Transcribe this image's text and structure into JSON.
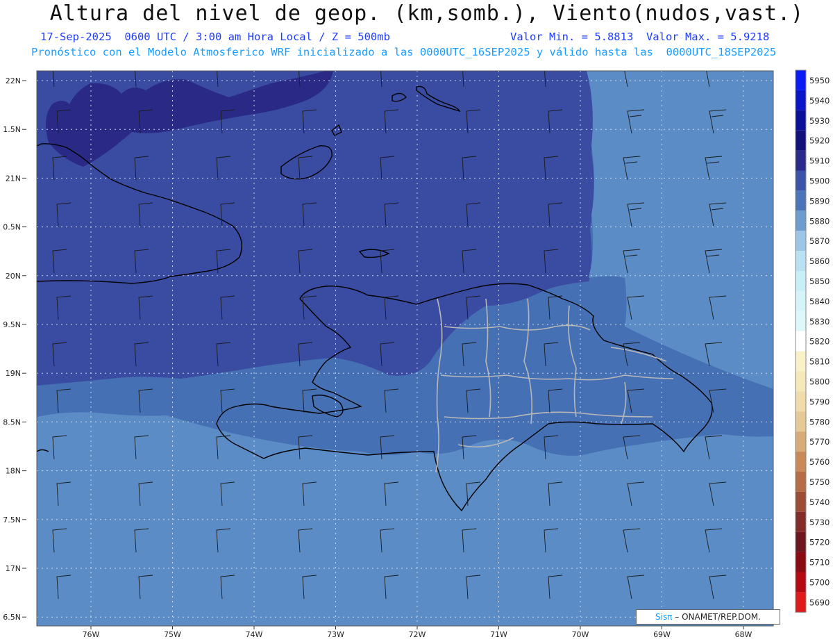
{
  "header": {
    "title": "Altura del nivel de geop. (km,somb.), Viento(nudos,vast.)",
    "date_line": "17-Sep-2025  0600 UTC / 3:00 am Hora Local / Z = 500mb",
    "minmax_line": "Valor Min. = 5.8813  Valor Max. = 5.9218",
    "model_line": "Pronóstico con el Modelo Atmosferico WRF inicializado a las 0000UTC_16SEP2025 y válido hasta las  0000UTC_18SEP2025"
  },
  "axes": {
    "lat_labels": [
      "22N",
      "1.5N",
      "21N",
      "0.5N",
      "20N",
      "9.5N",
      "19N",
      "8.5N",
      "18N",
      "7.5N",
      "17N",
      "6.5N"
    ],
    "lon_labels": [
      "76W",
      "75W",
      "74W",
      "73W",
      "72W",
      "71W",
      "70W",
      "69W",
      "68W"
    ]
  },
  "colorbar": {
    "labels": [
      "5950",
      "5940",
      "5930",
      "5920",
      "5910",
      "5900",
      "5890",
      "5880",
      "5870",
      "5860",
      "5850",
      "5840",
      "5830",
      "5820",
      "5810",
      "5800",
      "5790",
      "5780",
      "5770",
      "5760",
      "5750",
      "5740",
      "5730",
      "5720",
      "5710",
      "5700",
      "5690"
    ],
    "colors": [
      "#0a1cf5",
      "#0a14c8",
      "#0b0f9a",
      "#12107a",
      "#2a2a8a",
      "#3b53a8",
      "#4a75b8",
      "#6e9ccf",
      "#9dc6e6",
      "#b9e1f2",
      "#c8eef7",
      "#d6f3fa",
      "#ddf7fb",
      "#ffffff",
      "#fbf1c8",
      "#f6e8b8",
      "#efdcaa",
      "#e6c997",
      "#d9ab76",
      "#c98a59",
      "#b66c45",
      "#9d4c35",
      "#842c2a",
      "#6e1720",
      "#8a0b14",
      "#b40a12",
      "#e01a1a"
    ]
  },
  "map_colors": {
    "band_5920": "#2a2a86",
    "band_5910": "#3a4ba2",
    "band_5900": "#4670b4",
    "band_5890": "#5b8cc6",
    "coast": "#000000",
    "provinces": "#b8b8b8"
  },
  "credit": {
    "brand": "Sisπ",
    "text": "– ONAMET/REP.DOM."
  }
}
